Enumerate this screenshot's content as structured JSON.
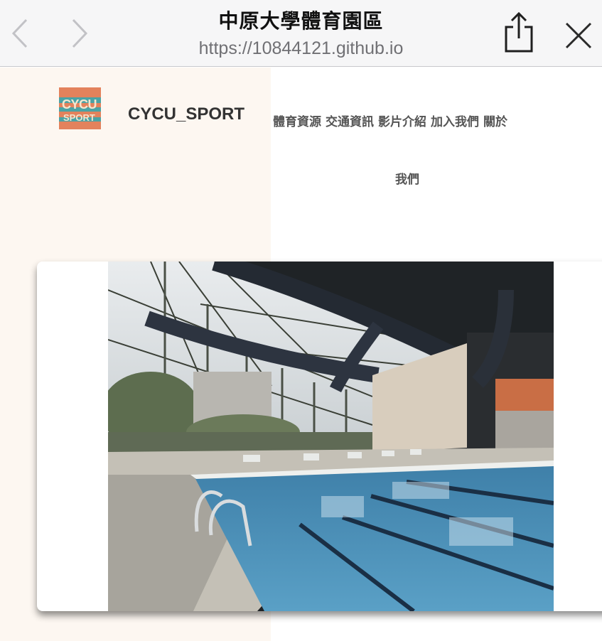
{
  "browser": {
    "title": "中原大學體育園區",
    "url": "https://10844121.github.io",
    "icons": {
      "back": "chevron-left-icon",
      "forward": "chevron-right-icon",
      "share": "share-icon",
      "close": "close-icon"
    }
  },
  "site": {
    "logo": {
      "line1": "CYCU",
      "line2": "SPORT"
    },
    "brand": "CYCU_SPORT",
    "nav": [
      "體育資源",
      "交通資訊",
      "影片介紹",
      "加入我們",
      "關於"
    ],
    "nav_wrap": "我們"
  },
  "hero": {
    "image": "indoor-swimming-pool-photo"
  },
  "colors": {
    "left_panel": "#fdf7f1",
    "logo_teal": "#4aa3a5",
    "logo_orange": "#e3825c",
    "text_dark": "#333333"
  }
}
